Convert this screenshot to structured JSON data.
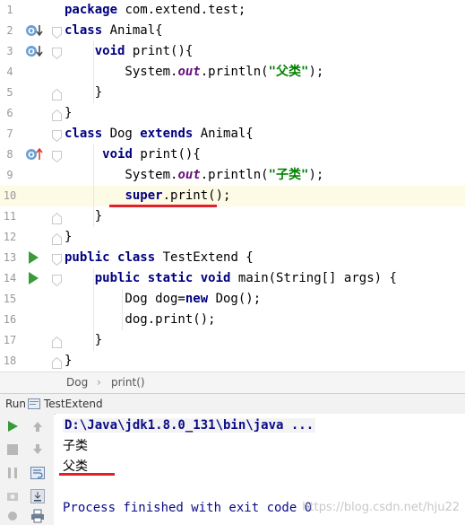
{
  "editor": {
    "lines": [
      {
        "num": "1",
        "parts": [
          {
            "t": "package ",
            "c": "kw"
          },
          {
            "t": "com.extend.test;",
            "c": ""
          }
        ]
      },
      {
        "num": "2",
        "parts": [
          {
            "t": "class ",
            "c": "kw"
          },
          {
            "t": "Animal{",
            "c": ""
          }
        ]
      },
      {
        "num": "3",
        "parts": [
          {
            "t": "    ",
            "c": ""
          },
          {
            "t": "void ",
            "c": "kw"
          },
          {
            "t": "print(){",
            "c": ""
          }
        ]
      },
      {
        "num": "4",
        "parts": [
          {
            "t": "        System.",
            "c": ""
          },
          {
            "t": "out",
            "c": "field"
          },
          {
            "t": ".println(",
            "c": ""
          },
          {
            "t": "\"父类\"",
            "c": "str"
          },
          {
            "t": ");",
            "c": ""
          }
        ]
      },
      {
        "num": "5",
        "parts": [
          {
            "t": "    }",
            "c": ""
          }
        ]
      },
      {
        "num": "6",
        "parts": [
          {
            "t": "}",
            "c": ""
          }
        ]
      },
      {
        "num": "7",
        "parts": [
          {
            "t": "class ",
            "c": "kw"
          },
          {
            "t": "Dog ",
            "c": ""
          },
          {
            "t": "extends ",
            "c": "kw"
          },
          {
            "t": "Animal{",
            "c": ""
          }
        ]
      },
      {
        "num": "8",
        "parts": [
          {
            "t": "     ",
            "c": ""
          },
          {
            "t": "void ",
            "c": "kw"
          },
          {
            "t": "print(){",
            "c": ""
          }
        ]
      },
      {
        "num": "9",
        "parts": [
          {
            "t": "        System.",
            "c": ""
          },
          {
            "t": "out",
            "c": "field"
          },
          {
            "t": ".println(",
            "c": ""
          },
          {
            "t": "\"子类\"",
            "c": "str"
          },
          {
            "t": ");",
            "c": ""
          }
        ]
      },
      {
        "num": "10",
        "parts": [
          {
            "t": "        ",
            "c": ""
          },
          {
            "t": "super",
            "c": "kw"
          },
          {
            "t": ".print();",
            "c": ""
          }
        ]
      },
      {
        "num": "11",
        "parts": [
          {
            "t": "    }",
            "c": ""
          }
        ]
      },
      {
        "num": "12",
        "parts": [
          {
            "t": "}",
            "c": ""
          }
        ]
      },
      {
        "num": "13",
        "parts": [
          {
            "t": "public ",
            "c": "kw"
          },
          {
            "t": "class ",
            "c": "kw"
          },
          {
            "t": "TestExtend {",
            "c": ""
          }
        ]
      },
      {
        "num": "14",
        "parts": [
          {
            "t": "    ",
            "c": ""
          },
          {
            "t": "public ",
            "c": "kw"
          },
          {
            "t": "static ",
            "c": "kw"
          },
          {
            "t": "void ",
            "c": "kw"
          },
          {
            "t": "main(String[] args) {",
            "c": ""
          }
        ]
      },
      {
        "num": "15",
        "parts": [
          {
            "t": "        Dog dog=",
            "c": ""
          },
          {
            "t": "new ",
            "c": "kw"
          },
          {
            "t": "Dog();",
            "c": ""
          }
        ]
      },
      {
        "num": "16",
        "parts": [
          {
            "t": "        dog.print();",
            "c": ""
          }
        ]
      },
      {
        "num": "17",
        "parts": [
          {
            "t": "    }",
            "c": ""
          }
        ]
      },
      {
        "num": "18",
        "parts": [
          {
            "t": "}",
            "c": ""
          }
        ]
      }
    ]
  },
  "breadcrumb": {
    "item1": "Dog",
    "sep": "›",
    "item2": "print()"
  },
  "run_tab": {
    "label": "Run",
    "config": "TestExtend"
  },
  "console": {
    "command": "D:\\Java\\jdk1.8.0_131\\bin\\java ...",
    "out1": "子类",
    "out2": "父类",
    "finish": "Process finished with exit code 0"
  },
  "watermark": "https://blog.csdn.net/hju22",
  "colors": {
    "keyword": "#000080",
    "string": "#008000",
    "underline": "#e0202b",
    "run_green": "#3a9a3a"
  }
}
